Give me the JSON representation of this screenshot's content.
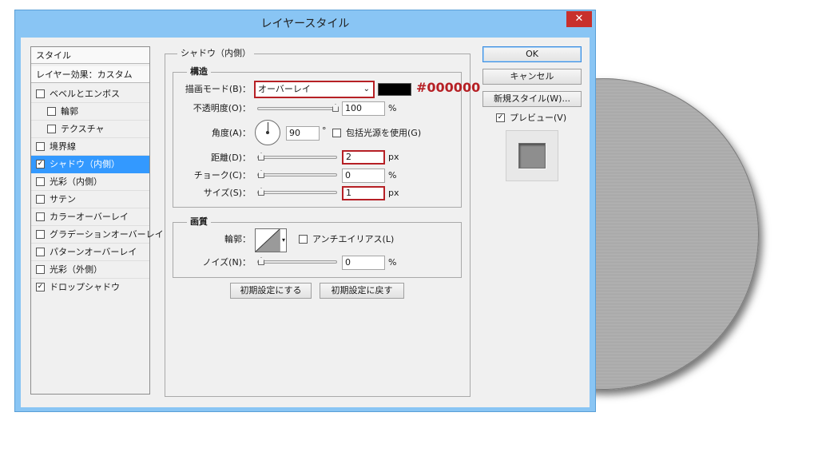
{
  "window": {
    "title": "レイヤースタイル",
    "close_icon": "✕"
  },
  "style_list": {
    "header": "スタイル",
    "subheader": "レイヤー効果：カスタム",
    "items": [
      {
        "label": "ベベルとエンボス",
        "checked": false
      },
      {
        "label": "輪郭",
        "checked": false
      },
      {
        "label": "テクスチャ",
        "checked": false
      },
      {
        "label": "境界線",
        "checked": false
      },
      {
        "label": "シャドウ（内側）",
        "checked": true,
        "selected": true
      },
      {
        "label": "光彩（内側）",
        "checked": false
      },
      {
        "label": "サテン",
        "checked": false
      },
      {
        "label": "カラーオーバーレイ",
        "checked": false
      },
      {
        "label": "グラデーションオーバーレイ",
        "checked": false
      },
      {
        "label": "パターンオーバーレイ",
        "checked": false
      },
      {
        "label": "光彩（外側）",
        "checked": false
      },
      {
        "label": "ドロップシャドウ",
        "checked": true
      }
    ]
  },
  "panel": {
    "title": "シャドウ（内側）",
    "structure": {
      "title": "構造",
      "blend_mode_label": "描画モード(B)：",
      "blend_mode_value": "オーバーレイ",
      "color_hex": "#000000",
      "color_annotation": "#000000",
      "opacity_label": "不透明度(O)：",
      "opacity_value": "100",
      "opacity_unit": "%",
      "angle_label": "角度(A)：",
      "angle_value": "90",
      "angle_unit": "°",
      "global_light_label": "包括光源を使用(G)",
      "global_light_checked": false,
      "distance_label": "距離(D)：",
      "distance_value": "2",
      "distance_unit": "px",
      "choke_label": "チョーク(C)：",
      "choke_value": "0",
      "choke_unit": "%",
      "size_label": "サイズ(S)：",
      "size_value": "1",
      "size_unit": "px"
    },
    "quality": {
      "title": "画質",
      "contour_label": "輪郭：",
      "antialias_label": "アンチエイリアス(L)",
      "antialias_checked": false,
      "noise_label": "ノイズ(N)：",
      "noise_value": "0",
      "noise_unit": "%"
    },
    "make_default_label": "初期設定にする",
    "reset_default_label": "初期設定に戻す"
  },
  "buttons": {
    "ok": "OK",
    "cancel": "キャンセル",
    "new_style": "新規スタイル(W)...",
    "preview_label": "プレビュー(V)",
    "preview_checked": true
  },
  "colors": {
    "accent": "#b62025",
    "selection": "#3399ff",
    "titlebar": "#89c5f4"
  }
}
